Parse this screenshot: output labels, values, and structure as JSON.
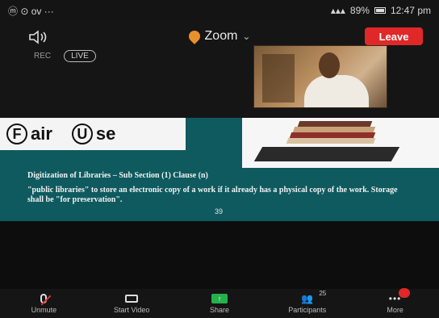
{
  "status_bar": {
    "left_text": "ⓜ ⊙ ᴏᴠ ···",
    "battery": "89%",
    "time": "12:47 pm"
  },
  "header": {
    "app_title": "Zoom",
    "leave_label": "Leave",
    "rec_badge": "REC",
    "live_badge": "LIVE"
  },
  "slide": {
    "title_logo": "Fair Use",
    "heading": "Digitization of Libraries – Sub Section (1) Clause (n)",
    "body": "\"public libraries\" to store an electronic copy of a work if it already has a physical copy of the work. Storage shall be \"for preservation\".",
    "footer_page": "39"
  },
  "toolbar": {
    "unmute_label": "Unmute",
    "start_video_label": "Start Video",
    "share_label": "Share",
    "participants_label": "Participants",
    "participants_count": "25",
    "more_label": "More"
  },
  "colors": {
    "leave_red": "#e02828",
    "share_green": "#26b24a",
    "slide_teal": "#0e5a5f",
    "zoom_shield_orange": "#e8902a"
  },
  "icons": [
    "speaker-icon",
    "shield-icon",
    "chevron-down-icon",
    "mic-muted-icon",
    "camera-off-icon",
    "share-screen-icon",
    "participants-icon",
    "more-icon"
  ]
}
